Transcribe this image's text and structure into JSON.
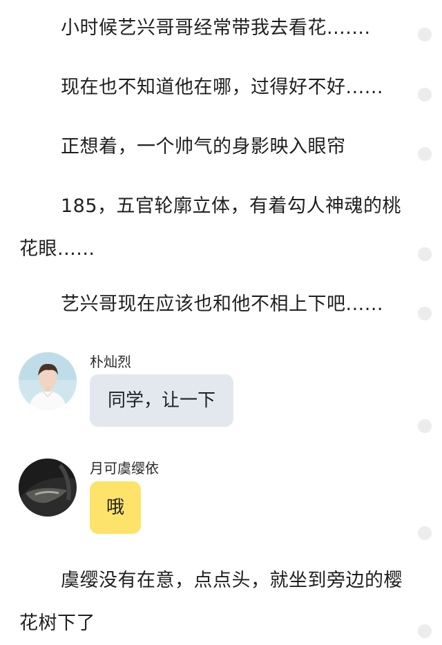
{
  "story": {
    "paragraphs": [
      "小时候艺兴哥哥经常带我去看花.......",
      "现在也不知道他在哪，过得好不好......",
      "正想着，一个帅气的身影映入眼帘",
      "185，五官轮廓立体，有着勾人神魂的桃花眼......",
      "艺兴哥现在应该也和他不相上下吧......",
      "虞缨没有在意，点点头，就坐到旁边的樱花树下了"
    ]
  },
  "chat": [
    {
      "speaker": "朴灿烈",
      "message": "同学，让一下",
      "bubble_color": "#e3e8ef"
    },
    {
      "speaker": "月可虞缨依",
      "message": "哦",
      "bubble_color": "#fde36a"
    }
  ],
  "colors": {
    "text": "#1f1f1f",
    "comment_dot": "#ececec"
  },
  "icons": {
    "avatar_1": "avatar-photo-young-man-white-sweater",
    "avatar_2": "avatar-photo-dark-hair",
    "comment_dot": "comment-dot-icon"
  }
}
